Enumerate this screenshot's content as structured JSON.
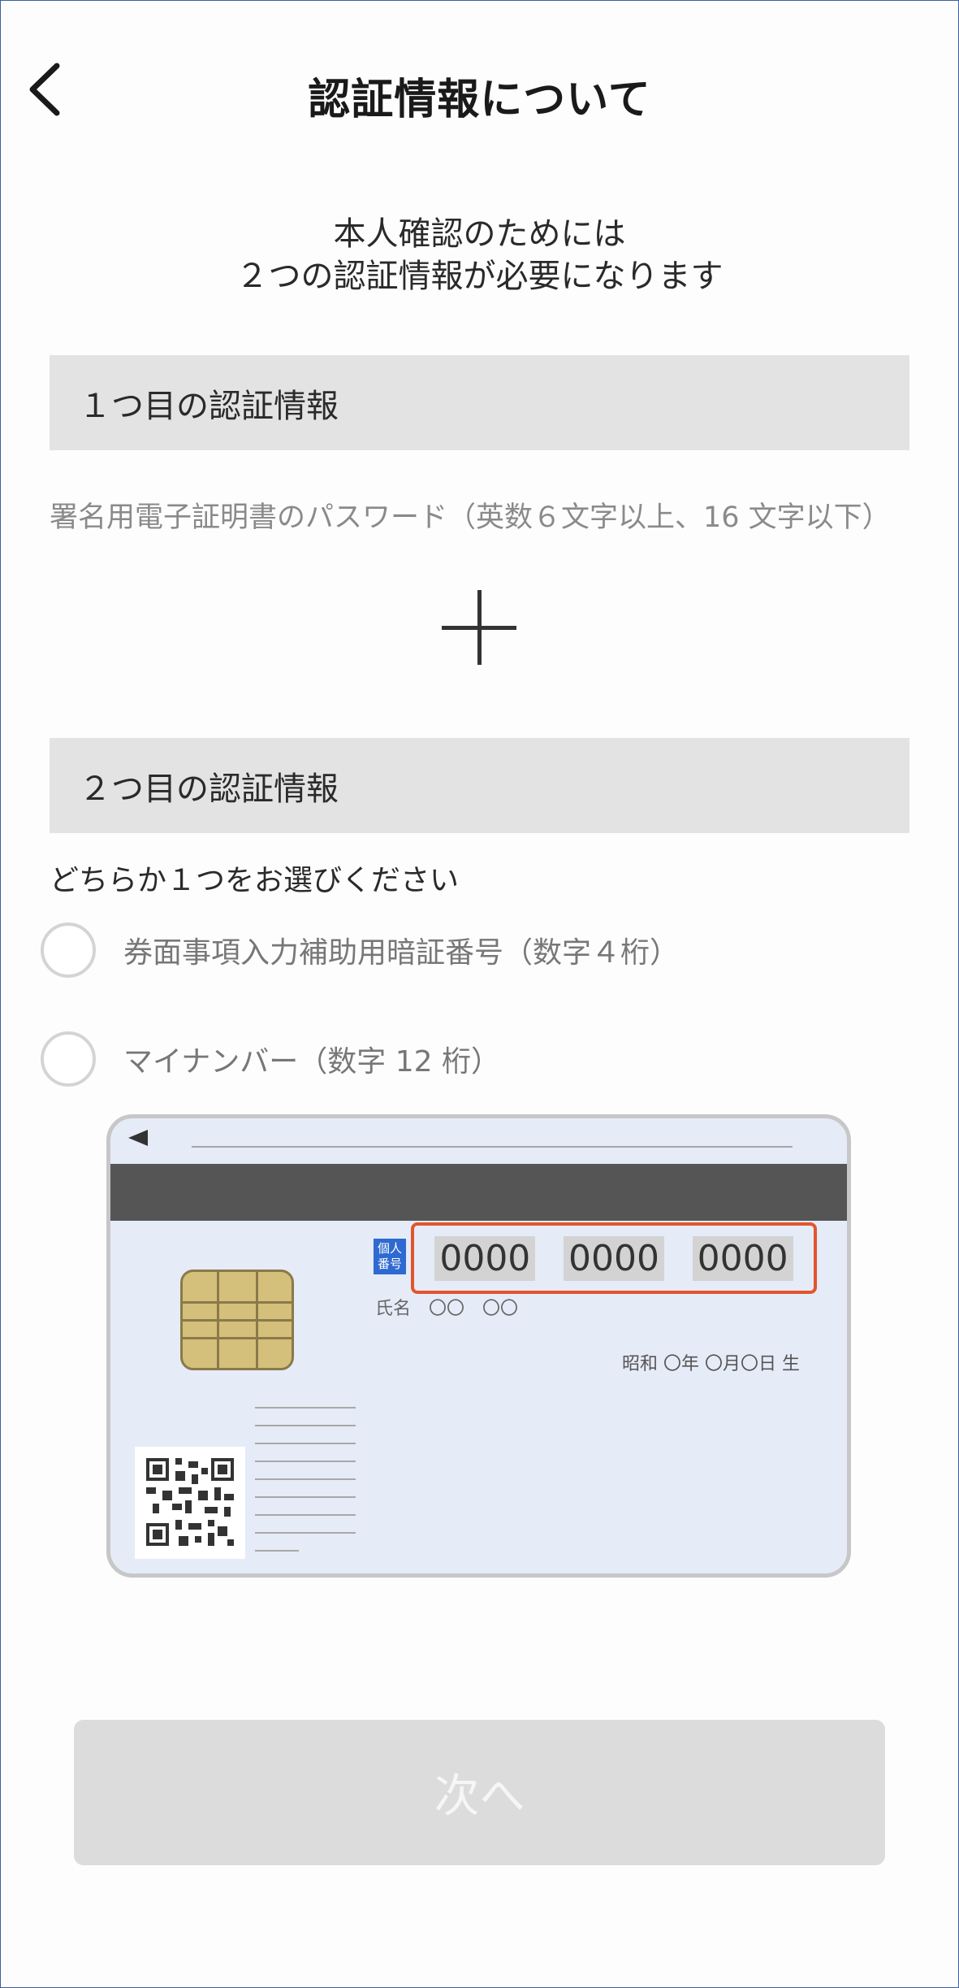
{
  "header": {
    "title": "認証情報について",
    "back_icon": "chevron-left-icon"
  },
  "intro": {
    "line1": "本人確認のためには",
    "line2": "２つの認証情報が必要になります"
  },
  "section1": {
    "heading": "１つ目の認証情報",
    "description": "署名用電子証明書のパスワード（英数６文字以上、16 文字以下）"
  },
  "section2": {
    "heading": "２つ目の認証情報",
    "prompt": "どちらか１つをお選びください",
    "options": [
      {
        "label": "券面事項入力補助用暗証番号（数字４桁）",
        "selected": false
      },
      {
        "label": "マイナンバー（数字 12 桁）",
        "selected": false
      }
    ]
  },
  "card": {
    "badge_line1": "個人",
    "badge_line2": "番号",
    "number_segments": [
      "0000",
      "0000",
      "0000"
    ],
    "name_row": "氏名　〇〇　〇〇",
    "dob": "昭和 〇年 〇月〇日 生",
    "highlight_color": "#e2552d",
    "card_color": "#e6ebf8"
  },
  "footer": {
    "next_label": "次へ",
    "next_enabled": false
  }
}
